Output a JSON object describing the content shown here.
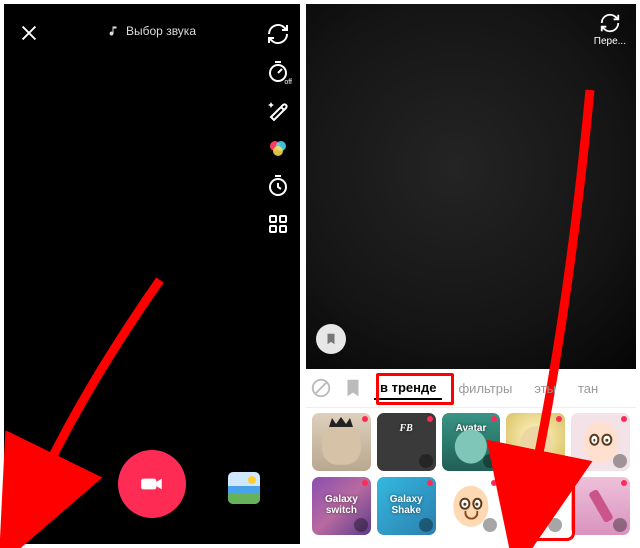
{
  "left": {
    "sound_label": "Выбор звука",
    "tools": [
      "flip",
      "speed",
      "beauty",
      "filters",
      "timer",
      "more"
    ]
  },
  "right": {
    "flip_label": "Пере...",
    "tabs": {
      "none": "",
      "favorites": "",
      "trending": "в тренде",
      "filters": "фильтры",
      "eff": "эты",
      "tan": "тан"
    },
    "effects_row1": [
      {
        "name": "effect-crown",
        "label": "",
        "bg": "#c8b9a6"
      },
      {
        "name": "effect-fb",
        "label": "FB",
        "bg": "#3a3a3a"
      },
      {
        "name": "effect-avatar",
        "label": "Avatar",
        "bg": "#2c7a6e"
      },
      {
        "name": "effect-glow",
        "label": "",
        "bg": "#d9c06a"
      },
      {
        "name": "effect-ghost",
        "label": "",
        "bg": "#f3e2e8"
      }
    ],
    "effects_row2": [
      {
        "name": "effect-galaxy-switch",
        "label": "Galaxy switch",
        "bg": "#7a4e9d"
      },
      {
        "name": "effect-galaxy-shake",
        "label": "Galaxy Shake",
        "bg": "#2aa3d1"
      },
      {
        "name": "effect-face",
        "label": "",
        "bg": "#ffffff"
      },
      {
        "name": "effect-devil-face",
        "label": "",
        "bg": "#ffffff"
      },
      {
        "name": "effect-lipstick",
        "label": "",
        "bg": "#e4aecd"
      }
    ]
  },
  "annotations": {
    "highlight_tab": "trending",
    "highlight_effect": "effect-devil-face"
  }
}
